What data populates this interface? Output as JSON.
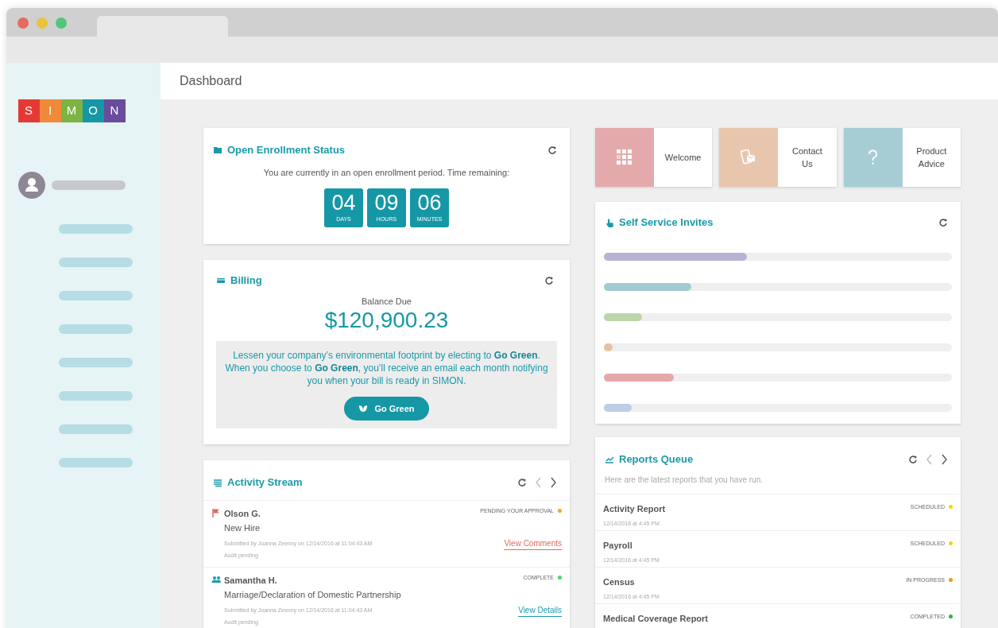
{
  "logo": [
    {
      "letter": "S",
      "color": "#e53935"
    },
    {
      "letter": "I",
      "color": "#f08a3a"
    },
    {
      "letter": "M",
      "color": "#7cb342"
    },
    {
      "letter": "O",
      "color": "#1697a6"
    },
    {
      "letter": "N",
      "color": "#6a4c9c"
    }
  ],
  "header": {
    "title": "Dashboard"
  },
  "enrollment": {
    "title": "Open Enrollment Status",
    "message": "You are currently in an open enrollment period. Time remaining:",
    "countdown": [
      {
        "value": "04",
        "unit": "DAYS"
      },
      {
        "value": "09",
        "unit": "HOURS"
      },
      {
        "value": "06",
        "unit": "MINUTES"
      }
    ]
  },
  "billing": {
    "title": "Billing",
    "balance_label": "Balance Due",
    "balance": "$120,900.23",
    "promo": "Lessen your company’s environmental footprint by electing to **Go Green**. When you choose to **Go Green**, you’ll receive an email each month notifying you when your bill is ready in SIMON.",
    "button": "Go Green"
  },
  "activity_stream": {
    "title": "Activity Stream",
    "items": [
      {
        "kind": "flag",
        "name": "Olson G.",
        "type": "New Hire",
        "submitted": "Submitted by Joanna Zeenny on 12/14/2016 at 11:04:43 AM",
        "audit": "Audit pending",
        "status": "PENDING YOUR APPROVAL",
        "color": "#f5a623",
        "link": "View Comments"
      },
      {
        "kind": "people",
        "name": "Samantha H.",
        "type": "Marriage/Declaration of Domestic Partnership",
        "submitted": "Submitted by Joanna Zeenny on 12/14/2016 at 11:04:43 AM",
        "audit": "Audit pending",
        "status": "COMPLETE",
        "color": "#4cd964",
        "link": "View Details"
      }
    ]
  },
  "tiles": [
    {
      "kind": "grid",
      "label": "Welcome"
    },
    {
      "kind": "contact",
      "label": "Contact Us"
    },
    {
      "kind": "question",
      "label": "Product Advice"
    }
  ],
  "self_service": {
    "title": "Self Service Invites",
    "bars": [
      {
        "level": 0.41,
        "color": "#b9b3d3"
      },
      {
        "level": 0.25,
        "color": "#a2cad3"
      },
      {
        "level": 0.11,
        "color": "#bcd6ab"
      },
      {
        "level": 0.025,
        "color": "#e8c2a4"
      },
      {
        "level": 0.2,
        "color": "#e5a9aa"
      },
      {
        "level": 0.08,
        "color": "#bccde4"
      }
    ]
  },
  "reports_queue": {
    "title": "Reports Queue",
    "subtitle": "Here are the latest reports that you have run.",
    "rows": [
      {
        "name": "Activity Report",
        "date": "12/14/2016 at 4:45 PM",
        "status": "SCHEDULED",
        "color": "#f8d20f"
      },
      {
        "name": "Payroll",
        "date": "12/14/2016 at 4:45 PM",
        "status": "SCHEDULED",
        "color": "#f8d20f"
      },
      {
        "name": "Census",
        "date": "12/14/2016 at 4:45 PM",
        "status": "IN PROGRESS",
        "color": "#f5922a"
      },
      {
        "name": "Medical Coverage Report",
        "status": "COMPLETED",
        "color": "#22b64a"
      }
    ]
  }
}
